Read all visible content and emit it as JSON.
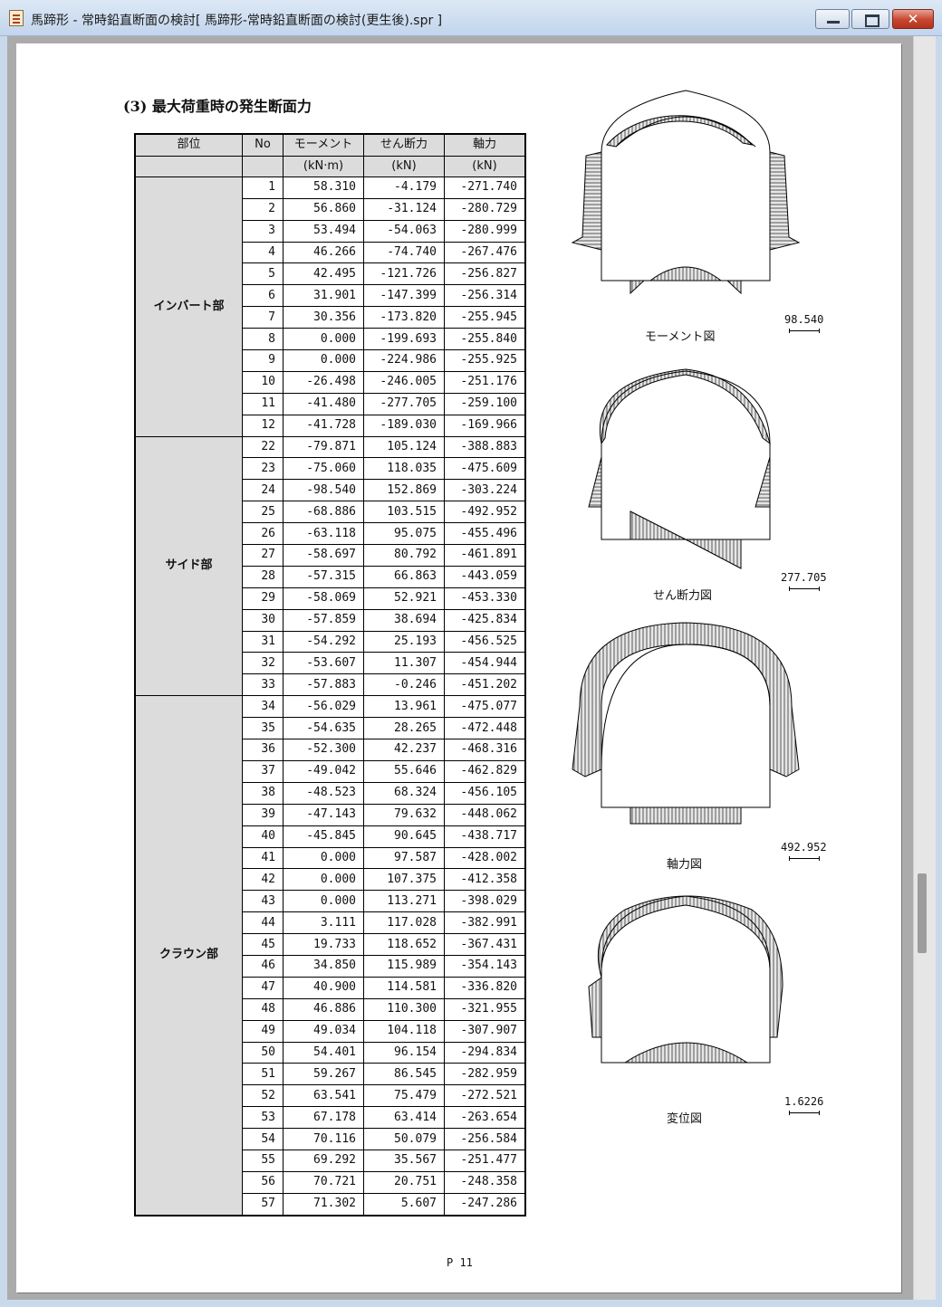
{
  "window": {
    "title": "馬蹄形 - 常時鉛直断面の検討[ 馬蹄形-常時鉛直断面の検討(更生後).spr ]",
    "close_glyph": "✕"
  },
  "document": {
    "heading": "(3)  最大荷重時の発生断面力",
    "page_number": "P 11",
    "table": {
      "headers": [
        "部位",
        "No",
        "モーメント",
        "せん断力",
        "軸力"
      ],
      "units": [
        "",
        "",
        "(kN·m)",
        "(kN)",
        "(kN)"
      ],
      "groups": [
        {
          "name": "インバート部",
          "rows": [
            [
              "1",
              "58.310",
              "-4.179",
              "-271.740"
            ],
            [
              "2",
              "56.860",
              "-31.124",
              "-280.729"
            ],
            [
              "3",
              "53.494",
              "-54.063",
              "-280.999"
            ],
            [
              "4",
              "46.266",
              "-74.740",
              "-267.476"
            ],
            [
              "5",
              "42.495",
              "-121.726",
              "-256.827"
            ],
            [
              "6",
              "31.901",
              "-147.399",
              "-256.314"
            ],
            [
              "7",
              "30.356",
              "-173.820",
              "-255.945"
            ],
            [
              "8",
              "0.000",
              "-199.693",
              "-255.840"
            ],
            [
              "9",
              "0.000",
              "-224.986",
              "-255.925"
            ],
            [
              "10",
              "-26.498",
              "-246.005",
              "-251.176"
            ],
            [
              "11",
              "-41.480",
              "-277.705",
              "-259.100"
            ],
            [
              "12",
              "-41.728",
              "-189.030",
              "-169.966"
            ]
          ]
        },
        {
          "name": "サイド部",
          "rows": [
            [
              "22",
              "-79.871",
              "105.124",
              "-388.883"
            ],
            [
              "23",
              "-75.060",
              "118.035",
              "-475.609"
            ],
            [
              "24",
              "-98.540",
              "152.869",
              "-303.224"
            ],
            [
              "25",
              "-68.886",
              "103.515",
              "-492.952"
            ],
            [
              "26",
              "-63.118",
              "95.075",
              "-455.496"
            ],
            [
              "27",
              "-58.697",
              "80.792",
              "-461.891"
            ],
            [
              "28",
              "-57.315",
              "66.863",
              "-443.059"
            ],
            [
              "29",
              "-58.069",
              "52.921",
              "-453.330"
            ],
            [
              "30",
              "-57.859",
              "38.694",
              "-425.834"
            ],
            [
              "31",
              "-54.292",
              "25.193",
              "-456.525"
            ],
            [
              "32",
              "-53.607",
              "11.307",
              "-454.944"
            ],
            [
              "33",
              "-57.883",
              "-0.246",
              "-451.202"
            ]
          ]
        },
        {
          "name": "クラウン部",
          "rows": [
            [
              "34",
              "-56.029",
              "13.961",
              "-475.077"
            ],
            [
              "35",
              "-54.635",
              "28.265",
              "-472.448"
            ],
            [
              "36",
              "-52.300",
              "42.237",
              "-468.316"
            ],
            [
              "37",
              "-49.042",
              "55.646",
              "-462.829"
            ],
            [
              "38",
              "-48.523",
              "68.324",
              "-456.105"
            ],
            [
              "39",
              "-47.143",
              "79.632",
              "-448.062"
            ],
            [
              "40",
              "-45.845",
              "90.645",
              "-438.717"
            ],
            [
              "41",
              "0.000",
              "97.587",
              "-428.002"
            ],
            [
              "42",
              "0.000",
              "107.375",
              "-412.358"
            ],
            [
              "43",
              "0.000",
              "113.271",
              "-398.029"
            ],
            [
              "44",
              "3.111",
              "117.028",
              "-382.991"
            ],
            [
              "45",
              "19.733",
              "118.652",
              "-367.431"
            ],
            [
              "46",
              "34.850",
              "115.989",
              "-354.143"
            ],
            [
              "47",
              "40.900",
              "114.581",
              "-336.820"
            ],
            [
              "48",
              "46.886",
              "110.300",
              "-321.955"
            ],
            [
              "49",
              "49.034",
              "104.118",
              "-307.907"
            ],
            [
              "50",
              "54.401",
              "96.154",
              "-294.834"
            ],
            [
              "51",
              "59.267",
              "86.545",
              "-282.959"
            ],
            [
              "52",
              "63.541",
              "75.479",
              "-272.521"
            ],
            [
              "53",
              "67.178",
              "63.414",
              "-263.654"
            ],
            [
              "54",
              "70.116",
              "50.079",
              "-256.584"
            ],
            [
              "55",
              "69.292",
              "35.567",
              "-251.477"
            ],
            [
              "56",
              "70.721",
              "20.751",
              "-248.358"
            ],
            [
              "57",
              "71.302",
              "5.607",
              "-247.286"
            ]
          ]
        }
      ]
    },
    "diagrams": [
      {
        "caption": "モーメント図",
        "scale": "98.540"
      },
      {
        "caption": "せん断力図",
        "scale": "277.705"
      },
      {
        "caption": "軸力図",
        "scale": "492.952"
      },
      {
        "caption": "変位図",
        "scale": "1.6226"
      }
    ]
  }
}
